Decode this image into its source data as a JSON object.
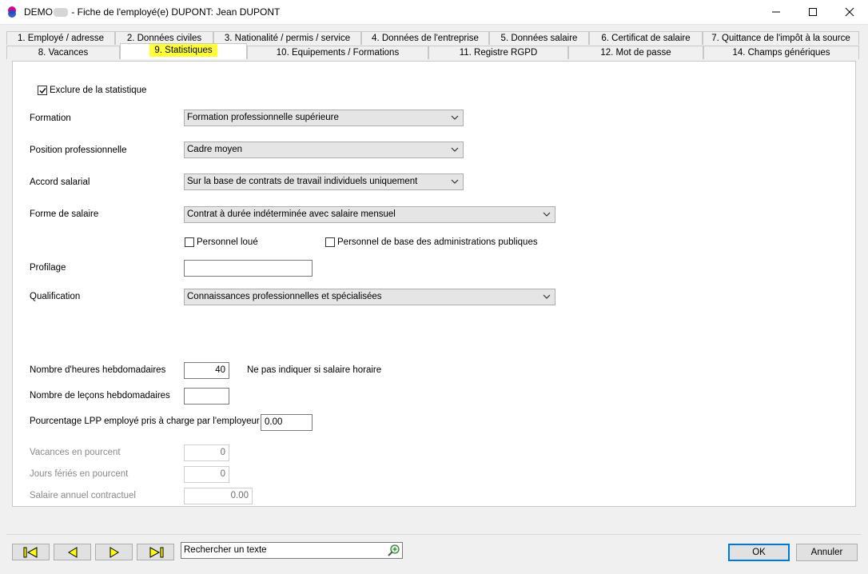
{
  "window": {
    "title_prefix": "DEMO",
    "title_suffix": " - Fiche de l'employé(e) DUPONT:  Jean DUPONT",
    "minimize_label": "",
    "maximize_label": "",
    "close_label": ""
  },
  "tabs_row1": [
    {
      "label": "1. Employé / adresse"
    },
    {
      "label": "2. Données civiles"
    },
    {
      "label": "3. Nationalité / permis / service"
    },
    {
      "label": "4. Données de l'entreprise"
    },
    {
      "label": "5. Données salaire"
    },
    {
      "label": "6. Certificat de salaire"
    },
    {
      "label": "7. Quittance de l'impôt à la source"
    }
  ],
  "tabs_row2": [
    {
      "label": "8. Vacances"
    },
    {
      "label": "9. Statistiques",
      "active": true
    },
    {
      "label": "10. Equipements / Formations"
    },
    {
      "label": "11. Registre RGPD"
    },
    {
      "label": "12. Mot de passe"
    },
    {
      "label": "14. Champs génériques"
    }
  ],
  "form": {
    "exclude_stats": {
      "label": "Exclure de la statistique",
      "checked": true
    },
    "formation": {
      "label": "Formation",
      "value": "Formation professionnelle supérieure"
    },
    "position": {
      "label": "Position professionnelle",
      "value": "Cadre moyen"
    },
    "accord": {
      "label": "Accord salarial",
      "value": "Sur la base de contrats de travail individuels uniquement"
    },
    "forme_salaire": {
      "label": "Forme de salaire",
      "value": "Contrat à durée indéterminée avec salaire mensuel"
    },
    "personnel_loue": {
      "label": "Personnel loué",
      "checked": false
    },
    "personnel_base": {
      "label": "Personnel de base des administrations publiques",
      "checked": false
    },
    "profilage": {
      "label": "Profilage",
      "value": ""
    },
    "qualification": {
      "label": "Qualification",
      "value": "Connaissances professionnelles et spécialisées"
    },
    "heures": {
      "label": "Nombre d'heures hebdomadaires",
      "value": "40",
      "hint": "Ne pas indiquer si salaire horaire"
    },
    "lecons": {
      "label": "Nombre de leçons hebdomadaires",
      "value": ""
    },
    "lpp": {
      "label": "Pourcentage LPP employé pris à charge par l'employeur",
      "value": "0.00"
    },
    "vacances_pct": {
      "label": "Vacances en pourcent",
      "value": "0"
    },
    "feries_pct": {
      "label": "Jours fériés en pourcent",
      "value": "0"
    },
    "salaire_annuel": {
      "label": "Salaire annuel contractuel",
      "value": "0.00"
    }
  },
  "footer": {
    "search_placeholder": "Rechercher un texte",
    "ok_label": "OK",
    "cancel_label": "Annuler"
  },
  "colors": {
    "highlight": "#ffff33",
    "accent": "#0078d7"
  }
}
